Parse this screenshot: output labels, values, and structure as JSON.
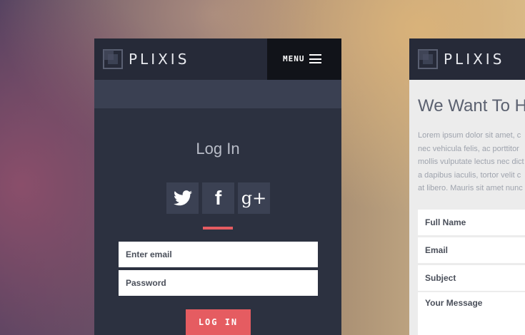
{
  "brand": {
    "name": "PLIXIS"
  },
  "left_screen": {
    "menu_label": "MENU",
    "login_title": "Log In",
    "social": [
      {
        "name": "twitter-icon"
      },
      {
        "name": "facebook-icon",
        "glyph": "f"
      },
      {
        "name": "google-plus-icon",
        "glyph": "g+"
      }
    ],
    "email_placeholder": "Enter email",
    "password_placeholder": "Password",
    "login_button": "LOG IN"
  },
  "right_screen": {
    "title": "We Want To Hea",
    "lorem_lines": [
      "Lorem ipsum dolor sit amet, c",
      "nec vehicula felis, ac porttitor",
      "mollis vulputate lectus nec dict",
      "a dapibus iaculis, tortor velit c",
      "at libero. Mauris sit amet nunc"
    ],
    "fields": {
      "full_name": "Full Name",
      "email": "Email",
      "subject": "Subject",
      "message": "Your Message"
    }
  },
  "colors": {
    "accent": "#e55c61",
    "dark_panel": "#2c3140",
    "header": "#262a38",
    "social_bg": "#3b4153"
  }
}
